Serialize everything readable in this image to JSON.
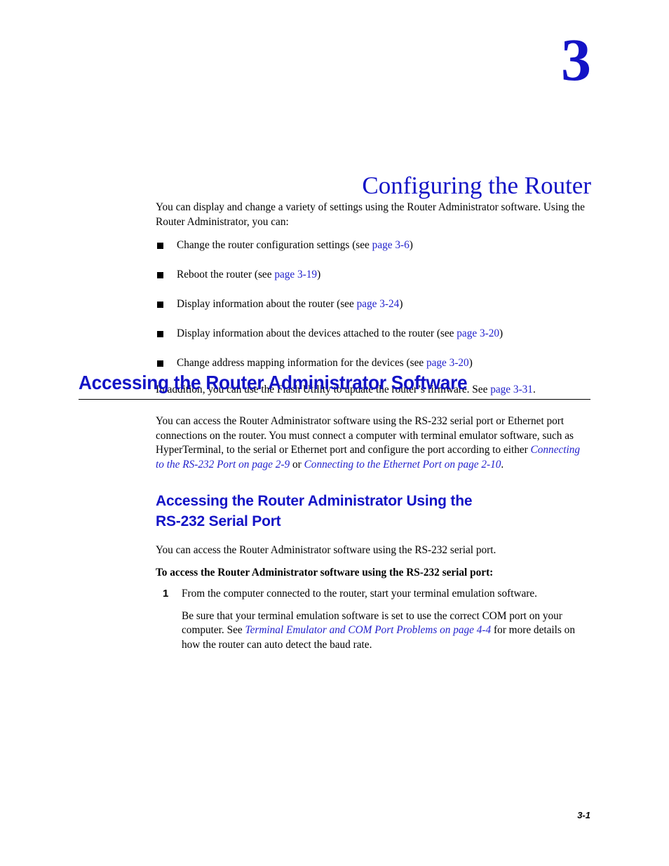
{
  "chapter": {
    "number": "3",
    "title": "Configuring the Router"
  },
  "intro": {
    "paragraph_prefix": "You can display and change a variety of settings using the Router Administrator software. Using the Router Administrator, you can:",
    "bullets": [
      {
        "text_before": "Change the router configuration settings (see ",
        "link": "page 3-6",
        "text_after": ")"
      },
      {
        "text_before": "Reboot the router (see ",
        "link": "page 3-19",
        "text_after": ")"
      },
      {
        "text_before": "Display information about the router (see ",
        "link": "page 3-24",
        "text_after": ")"
      },
      {
        "text_before": "Display information about the devices attached to the router (see ",
        "link": "page 3-20",
        "text_after": ")"
      },
      {
        "text_before": "Change address mapping information for the devices (see ",
        "link": "page 3-20",
        "text_after": ")"
      }
    ],
    "closing_before": "In addition, you can use the Flash Utility to update the router’s firmware. See ",
    "closing_link": "page 3-31",
    "closing_after": "."
  },
  "section": {
    "heading": "Accessing the Router Administrator Software",
    "paragraph_before_link1": "You can access the Router Administrator software using the RS-232 serial port or Ethernet port connections on the router. You must connect a computer with terminal emulator software, such as HyperTerminal, to the serial or Ethernet port and configure the port according to either ",
    "link1": "Connecting to the RS-232 Port on page 2-9",
    "between_links": " or ",
    "link2": "Connecting to the Ethernet Port on page 2-10",
    "paragraph_after_link2": "."
  },
  "subsection": {
    "heading_line1": "Accessing the Router Administrator Using the",
    "heading_line2": "RS-232 Serial Port",
    "paragraph": "You can access the Router Administrator software using the RS-232 serial port.",
    "lead_in": "To access the Router Administrator software using the RS-232 serial port:",
    "step_number": "1",
    "step_text": "From the computer connected to the router, start your terminal emulation software.",
    "step_sub_before": "Be sure that your terminal emulation software is set to use the correct COM port on your computer. See ",
    "step_sub_link": "Terminal Emulator and COM Port Problems on page 4-4",
    "step_sub_after": " for more details on how the router can auto detect the baud rate."
  },
  "footer": {
    "page_number": "3-1"
  },
  "colors": {
    "heading_blue": "#1313c6",
    "link_blue": "#2222cc",
    "text_black": "#000000",
    "rule_black": "#000000"
  }
}
